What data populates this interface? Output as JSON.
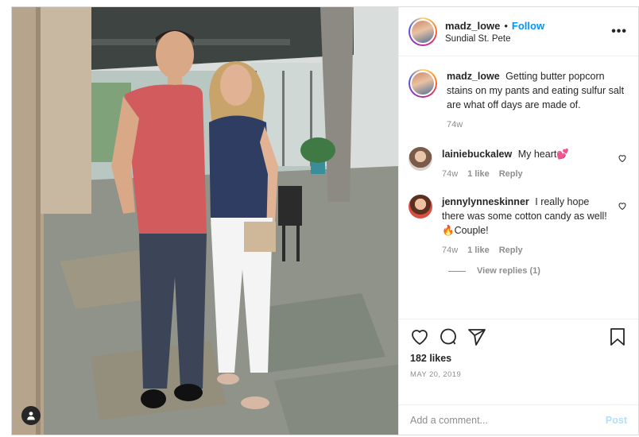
{
  "post": {
    "author": {
      "username": "madz_lowe",
      "follow_label": "Follow",
      "separator": "•",
      "location": "Sundial St. Pete"
    },
    "more_icon": "more-horizontal-icon",
    "caption": {
      "username": "madz_lowe",
      "text": "Getting butter popcorn stains on my pants and eating sulfur salt are what off days are made of.",
      "time": "74w"
    },
    "comments": [
      {
        "username": "lainiebuckalew",
        "text": "My heart💕",
        "time": "74w",
        "likes": "1 like",
        "reply_label": "Reply"
      },
      {
        "username": "jennylynneskinner",
        "text": "I really hope there was some cotton candy as well! 🔥Couple!",
        "time": "74w",
        "likes": "1 like",
        "reply_label": "Reply"
      }
    ],
    "view_replies": "View replies (1)",
    "likes": "182 likes",
    "date": "MAY 20, 2019",
    "comment_input": {
      "placeholder": "Add a comment...",
      "post_label": "Post"
    },
    "colors": {
      "link": "#0095f6",
      "muted": "#8e8e8e",
      "post_disabled": "#b2dffc"
    }
  }
}
